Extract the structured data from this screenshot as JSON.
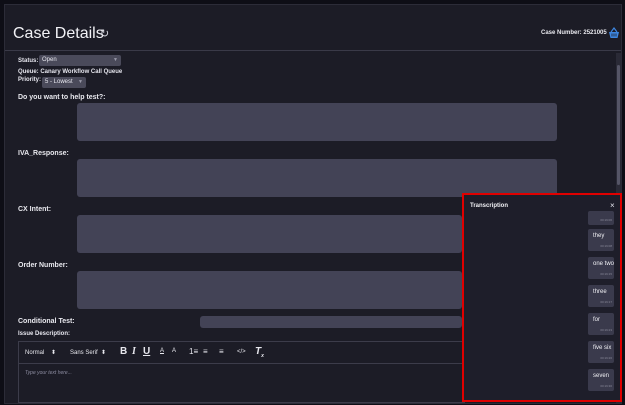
{
  "header": {
    "title": "Case Details",
    "refresh_icon": "↻",
    "case_number_label": "Case Number:",
    "case_number": "2521005",
    "basket_icon": "basket-icon"
  },
  "fields": {
    "status_label": "Status:",
    "status_value": "Open",
    "queue_label": "Queue:",
    "queue_value": "Canary Workflow Call Queue",
    "priority_label": "Priority:",
    "priority_value": "5 - Lowest",
    "help_test_label": "Do you want to help test?:",
    "iva_response_label": "IVA_Response:",
    "cx_intent_label": "CX Intent:",
    "order_number_label": "Order Number:",
    "conditional_test_label": "Conditional Test:",
    "issue_description_label": "Issue Description:"
  },
  "toolbar": {
    "header_select": "Normal",
    "font_select": "Sans Serif",
    "bold": "B",
    "italic": "I",
    "underline": "U",
    "font_color": "A",
    "highlight": "A",
    "ordered_list": "1≡",
    "bullet_list": "≡",
    "align": "≡",
    "code": "</>",
    "clear_format": "T",
    "clear_sub": "x"
  },
  "editor": {
    "placeholder": "Type your text here..."
  },
  "transcription": {
    "title": "Transcription",
    "close": "×",
    "messages": [
      {
        "text": "",
        "time": "00:19:06"
      },
      {
        "text": "they",
        "time": "00:19:08"
      },
      {
        "text": "one two",
        "time": "00:19:15"
      },
      {
        "text": "three",
        "time": "00:19:17"
      },
      {
        "text": "for",
        "time": "00:19:23"
      },
      {
        "text": "five six",
        "time": "00:19:26"
      },
      {
        "text": "seven",
        "time": "00:19:30"
      }
    ]
  }
}
